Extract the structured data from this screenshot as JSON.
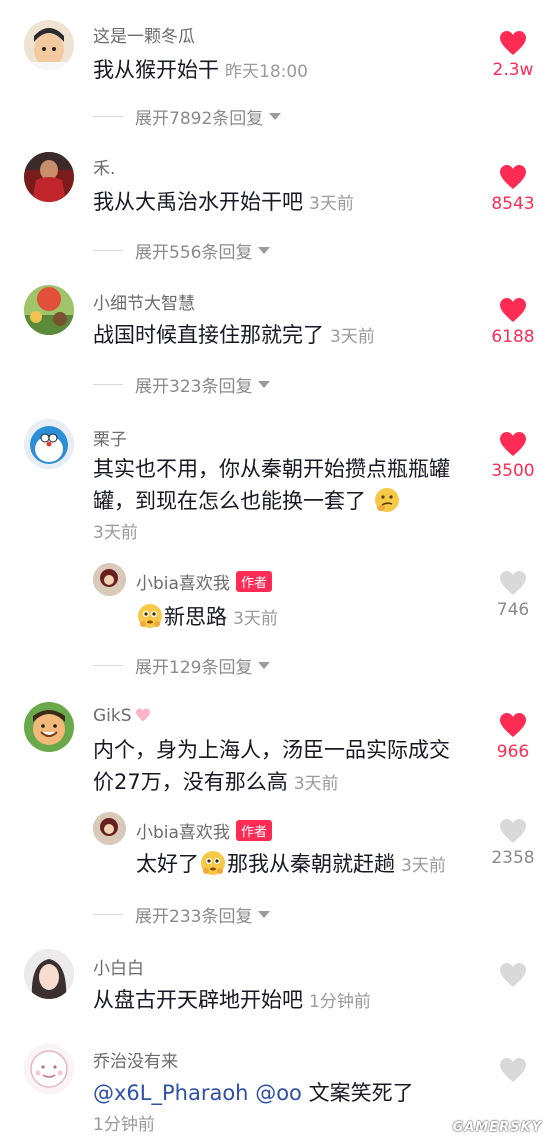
{
  "colors": {
    "like_red": "#fe2c55",
    "like_gray": "#d9d9d9",
    "mention_blue": "#2f4fa8"
  },
  "comments": [
    {
      "user": "这是一颗冬瓜",
      "text": "我从猴开始干",
      "time": "昨天18:00",
      "likes": "2.3w",
      "liked": true,
      "expand": "展开7892条回复",
      "avatar": "avatar-boy-icon"
    },
    {
      "user": "禾.",
      "text": "我从大禹治水开始干吧",
      "time": "3天前",
      "likes": "8543",
      "liked": true,
      "expand": "展开556条回复",
      "avatar": "avatar-red-shirt-icon"
    },
    {
      "user": "小细节大智慧",
      "text": "战国时候直接住那就完了",
      "time": "3天前",
      "likes": "6188",
      "liked": true,
      "expand": "展开323条回复",
      "avatar": "avatar-garden-icon"
    },
    {
      "user": "栗子",
      "text": "其实也不用，你从秦朝开始攒点瓶瓶罐罐，到现在怎么也能换一套了",
      "time": "3天前",
      "likes": "3500",
      "liked": true,
      "expand": "展开129条回复",
      "avatar": "avatar-doraemon-icon",
      "reply": {
        "user": "小bia喜欢我",
        "tag": "作者",
        "text": "新思路",
        "time": "3天前",
        "likes": "746"
      }
    },
    {
      "user": "GikS",
      "text": "内个，身为上海人，汤臣一品实际成交价27万，没有那么高",
      "time": "3天前",
      "likes": "966",
      "liked": true,
      "expand": "展开233条回复",
      "avatar": "avatar-smile-icon",
      "reply": {
        "user": "小bia喜欢我",
        "tag": "作者",
        "text_a": "太好了",
        "text_b": "那我从秦朝就赶趟",
        "time": "3天前",
        "likes": "2358"
      }
    },
    {
      "user": "小白白",
      "text": "从盘古开天辟地开始吧",
      "time": "1分钟前",
      "liked": false,
      "avatar": "avatar-girl-icon"
    },
    {
      "user": "乔治没有来",
      "mention1": "@x6L_Pharaoh",
      "mention2": "@oo",
      "text": "文案笑死了",
      "time": "1分钟前",
      "liked": false,
      "avatar": "avatar-cartoon-icon"
    }
  ],
  "watermark": "GAMERSKY"
}
